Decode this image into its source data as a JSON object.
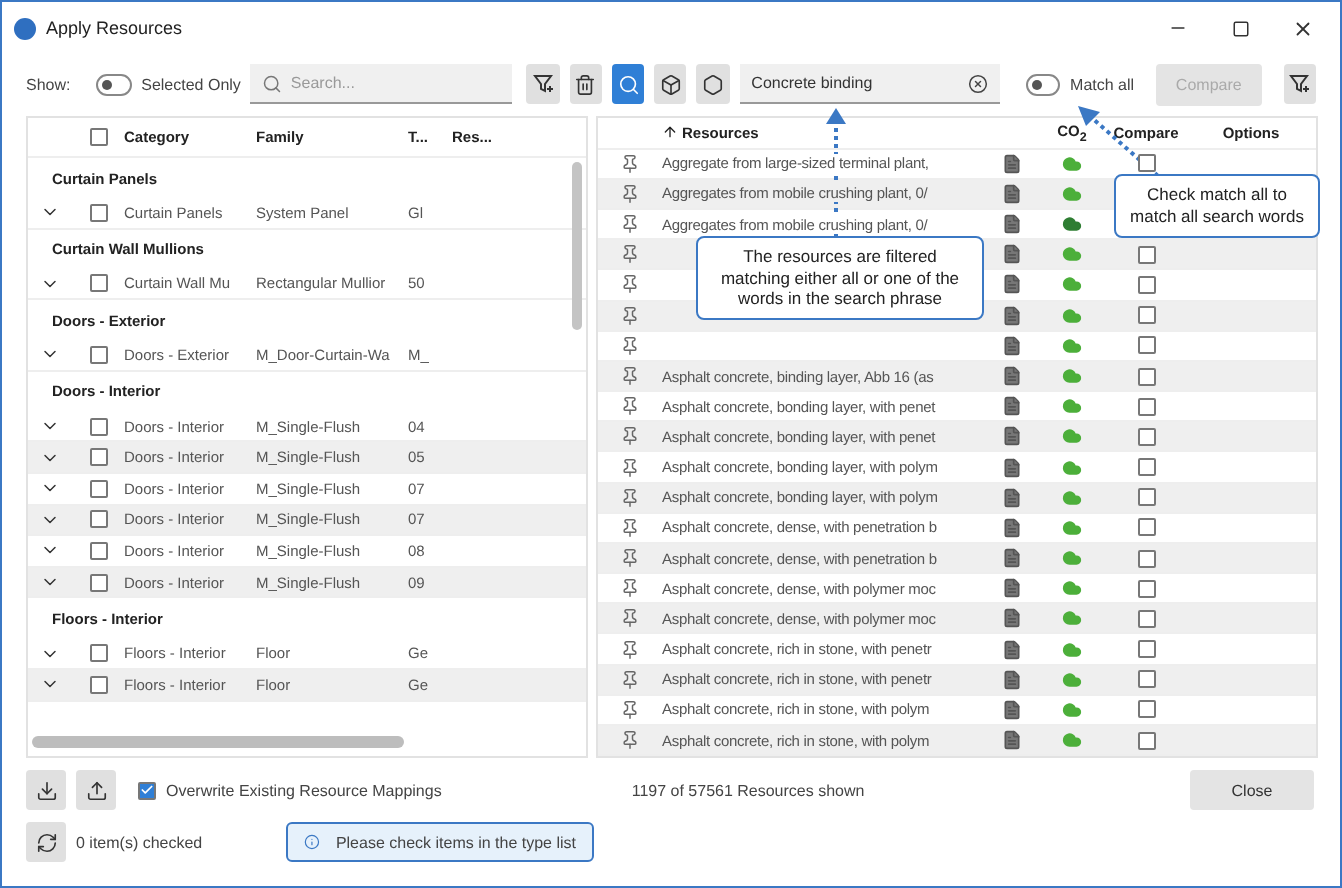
{
  "window": {
    "title": "Apply Resources"
  },
  "toolbar": {
    "show_label": "Show:",
    "selected_only": {
      "label": "Selected Only",
      "on": false
    },
    "search": {
      "placeholder": "Search..."
    },
    "resource_search": {
      "value": "Concrete binding"
    },
    "match_all": {
      "label": "Match all",
      "on": false
    },
    "compare_button": {
      "label": "Compare",
      "disabled": true
    }
  },
  "type_table": {
    "columns": [
      "Category",
      "Family",
      "T...",
      "Res..."
    ],
    "all_checked": false,
    "groups": [
      {
        "title": "Curtain Panels",
        "rows": [
          {
            "category": "Curtain Panels",
            "family": "System Panel",
            "type": "Gl",
            "checked": false
          }
        ]
      },
      {
        "title": "Curtain Wall Mullions",
        "rows": [
          {
            "category": "Curtain Wall Mu",
            "family": "Rectangular Mullior",
            "type": "50",
            "checked": false
          }
        ]
      },
      {
        "title": "Doors - Exterior",
        "rows": [
          {
            "category": "Doors - Exterior",
            "family": "M_Door-Curtain-Wa",
            "type": "M_",
            "checked": false
          }
        ]
      },
      {
        "title": "Doors - Interior",
        "rows": [
          {
            "category": "Doors - Interior",
            "family": "M_Single-Flush",
            "type": "04",
            "checked": false
          },
          {
            "category": "Doors - Interior",
            "family": "M_Single-Flush",
            "type": "05",
            "checked": false
          },
          {
            "category": "Doors - Interior",
            "family": "M_Single-Flush",
            "type": "07",
            "checked": false
          },
          {
            "category": "Doors - Interior",
            "family": "M_Single-Flush",
            "type": "07",
            "checked": false
          },
          {
            "category": "Doors - Interior",
            "family": "M_Single-Flush",
            "type": "08",
            "checked": false
          },
          {
            "category": "Doors - Interior",
            "family": "M_Single-Flush",
            "type": "09",
            "checked": false
          }
        ]
      },
      {
        "title": "Floors - Interior",
        "rows": [
          {
            "category": "Floors - Interior",
            "family": "Floor",
            "type": "Ge",
            "checked": false
          },
          {
            "category": "Floors - Interior",
            "family": "Floor",
            "type": "Ge",
            "checked": false
          }
        ]
      }
    ]
  },
  "resource_table": {
    "columns": [
      "Resources",
      "CO$_{2}$",
      "Compare",
      "Options"
    ],
    "rows": [
      {
        "name": "Aggregate from large-sized terminal plant,",
        "color": "#4caf3a",
        "compare_checked": false
      },
      {
        "name": "Aggregates from mobile crushing plant, 0/",
        "color": "#4caf3a"
      },
      {
        "name": "Aggregates from mobile crushing plant, 0/",
        "color": "#2e7d32"
      },
      {
        "color": "#4caf3a",
        "compare_checked": false
      },
      {
        "color": "#4caf3a",
        "compare_checked": false
      },
      {
        "color": "#4caf3a",
        "compare_checked": false
      },
      {
        "color": "#4caf3a",
        "compare_checked": false
      },
      {
        "name": "Asphalt concrete, binding layer, Abb 16 (as",
        "color": "#4caf3a",
        "compare_checked": false
      },
      {
        "name": "Asphalt concrete, bonding layer, with penet",
        "color": "#4caf3a",
        "compare_checked": false
      },
      {
        "name": "Asphalt concrete, bonding layer, with penet",
        "color": "#4caf3a",
        "compare_checked": false
      },
      {
        "name": "Asphalt concrete, bonding layer, with polym",
        "color": "#4caf3a",
        "compare_checked": false
      },
      {
        "name": "Asphalt concrete, bonding layer, with polym",
        "color": "#4caf3a",
        "compare_checked": false
      },
      {
        "name": "Asphalt concrete, dense, with penetration b",
        "color": "#4caf3a",
        "compare_checked": false
      },
      {
        "name": "Asphalt concrete, dense, with penetration b",
        "color": "#4caf3a",
        "compare_checked": false
      },
      {
        "name": "Asphalt concrete, dense, with polymer moc",
        "color": "#4caf3a",
        "compare_checked": false
      },
      {
        "name": "Asphalt concrete, dense, with polymer moc",
        "color": "#4caf3a",
        "compare_checked": false
      },
      {
        "name": "Asphalt concrete, rich in stone, with penetr",
        "color": "#4caf3a",
        "compare_checked": false
      },
      {
        "name": "Asphalt concrete, rich in stone, with penetr",
        "color": "#4caf3a",
        "compare_checked": false
      },
      {
        "name": "Asphalt concrete, rich in stone, with polym",
        "color": "#4caf3a",
        "compare_checked": false
      },
      {
        "name": "Asphalt concrete, rich in stone, with polym",
        "color": "#4caf3a",
        "compare_checked": false
      }
    ]
  },
  "callouts": [
    {
      "text": "The resources are filtered matching either all or one of the words in the search phrase"
    },
    {
      "text": "Check match all to match all search words"
    }
  ],
  "footer": {
    "overwrite": {
      "label": "Overwrite Existing Resource Mappings",
      "checked": true
    },
    "count": "1197 of 57561 Resources shown",
    "close": "Close",
    "checked_count": "0 item(s) checked",
    "info": "Please check items in the type list"
  }
}
